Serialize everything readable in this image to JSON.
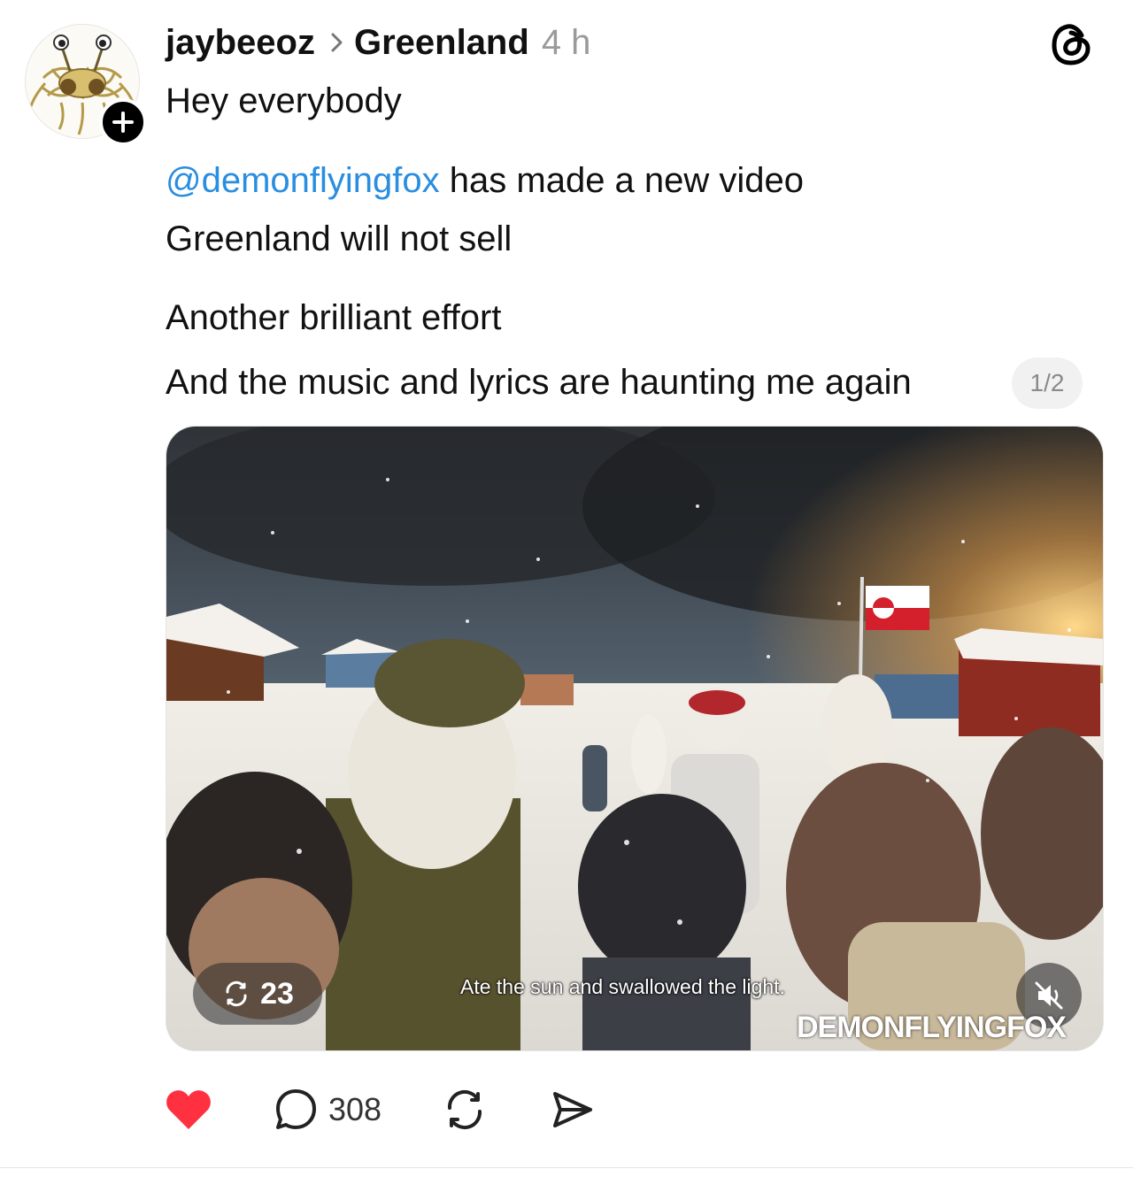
{
  "post": {
    "username": "jaybeeoz",
    "topic": "Greenland",
    "time": "4 h",
    "lines": {
      "greeting": "Hey everybody",
      "mention": "@demonflyingfox",
      "mention_rest": " has made a new video",
      "line3": "Greenland will not sell",
      "line4": "Another brilliant effort",
      "line5": "And the music and lyrics are haunting me again"
    },
    "page_indicator": "1/2"
  },
  "media": {
    "repost_count": "23",
    "caption": "Ate the sun and swallowed the light.",
    "watermark": "DEMONFLYINGFOX"
  },
  "actions": {
    "liked": true,
    "reply_count": "308"
  },
  "icons": {
    "follow": "plus-icon",
    "logo": "threads-logo-icon",
    "like": "heart-icon",
    "reply": "reply-icon",
    "repost": "repost-icon",
    "share": "share-icon",
    "mute": "muted-speaker-icon"
  },
  "colors": {
    "like": "#ff3040",
    "mention": "#2a8ee0",
    "time": "#9a9a9a"
  }
}
